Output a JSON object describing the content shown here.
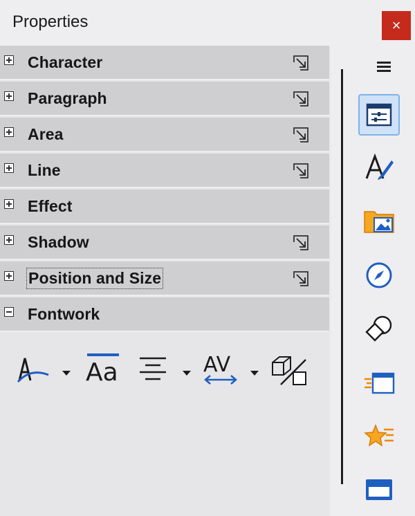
{
  "window": {
    "title": "Properties",
    "close_symbol": "×"
  },
  "sections": [
    {
      "label": "Character",
      "expanded": false,
      "has_more": true
    },
    {
      "label": "Paragraph",
      "expanded": false,
      "has_more": true
    },
    {
      "label": "Area",
      "expanded": false,
      "has_more": true
    },
    {
      "label": "Line",
      "expanded": false,
      "has_more": true
    },
    {
      "label": "Effect",
      "expanded": false,
      "has_more": false
    },
    {
      "label": "Shadow",
      "expanded": false,
      "has_more": true
    },
    {
      "label": "Position and Size",
      "expanded": false,
      "has_more": true,
      "focused": true
    },
    {
      "label": "Fontwork",
      "expanded": true,
      "has_more": false
    }
  ],
  "fontwork_toolbar": {
    "items": [
      {
        "icon": "fontwork-shape-icon",
        "dropdown": true
      },
      {
        "icon": "fontwork-same-letter-heights-icon",
        "dropdown": false,
        "text": "Aa"
      },
      {
        "icon": "fontwork-alignment-icon",
        "dropdown": true
      },
      {
        "icon": "fontwork-character-spacing-icon",
        "dropdown": true,
        "text": "AV"
      },
      {
        "icon": "toggle-extrusion-icon",
        "dropdown": false
      }
    ]
  },
  "tabbar": {
    "tabs": [
      {
        "icon": "properties-icon",
        "active": true
      },
      {
        "icon": "styles-icon",
        "active": false
      },
      {
        "icon": "gallery-icon",
        "active": false
      },
      {
        "icon": "navigator-icon",
        "active": false
      },
      {
        "icon": "shapes-icon",
        "active": false
      },
      {
        "icon": "slide-transition-icon",
        "active": false
      },
      {
        "icon": "animation-icon",
        "active": false
      },
      {
        "icon": "master-slides-icon",
        "active": false
      }
    ]
  },
  "colors": {
    "section_header": "#cfced1",
    "close_button": "#c42b1c",
    "active_tab": "#cfe2f7",
    "accent_blue": "#1f5fbf",
    "accent_orange": "#f08a00"
  }
}
